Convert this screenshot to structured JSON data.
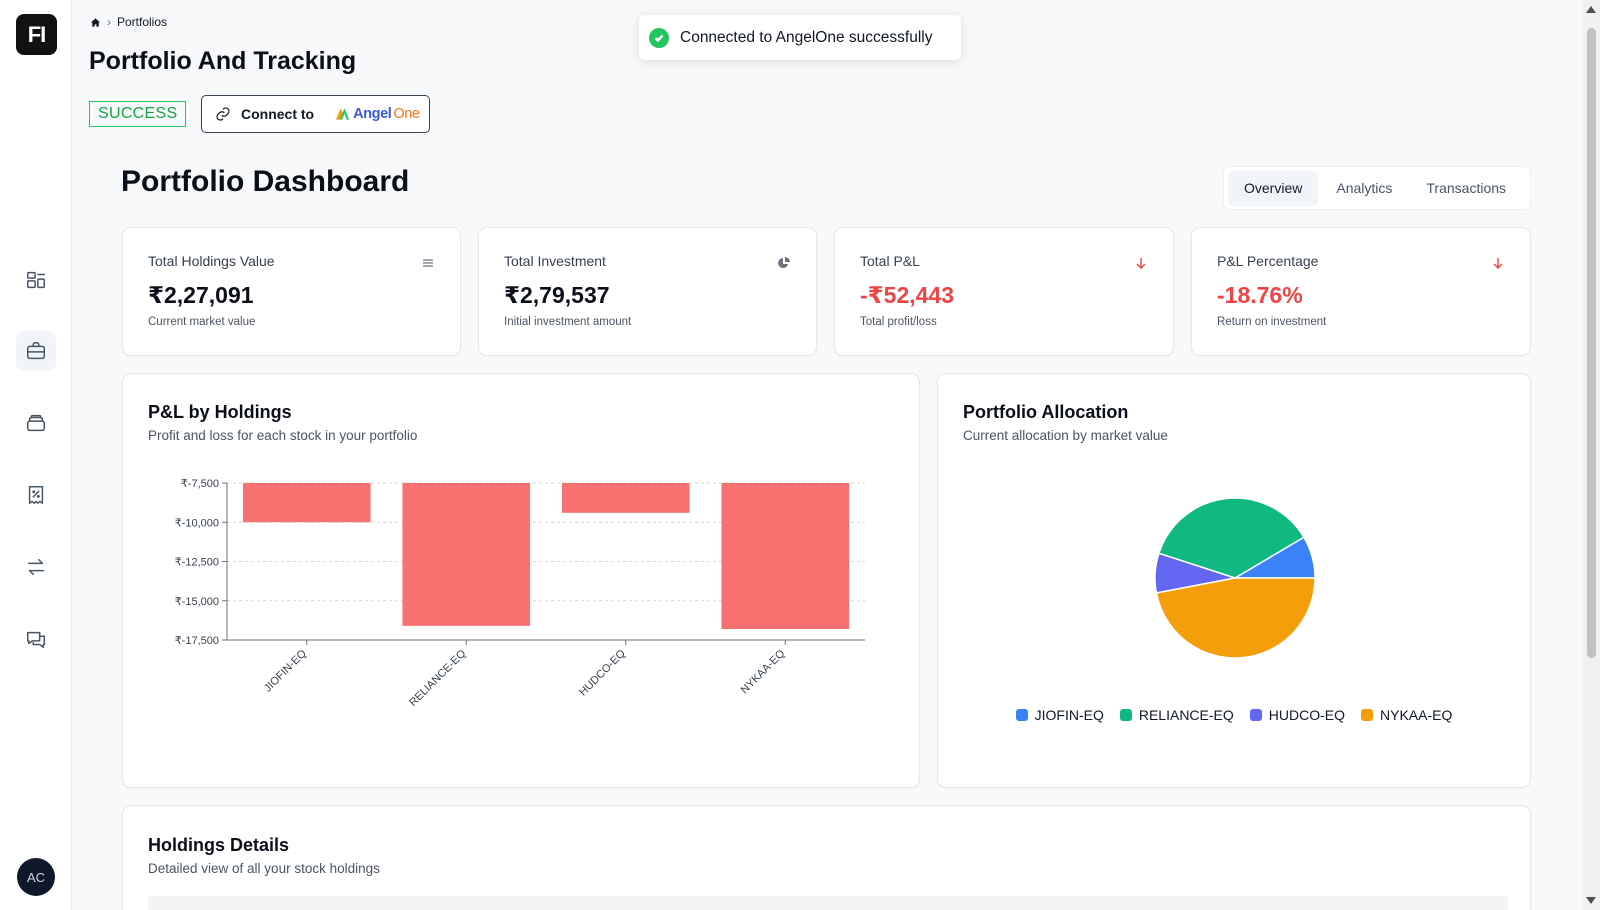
{
  "sidebar": {
    "logo": "FI",
    "items": [
      {
        "name": "dashboard",
        "icon": "dashboard-icon"
      },
      {
        "name": "portfolio",
        "icon": "briefcase-icon",
        "active": true
      },
      {
        "name": "accounts",
        "icon": "layers-icon"
      },
      {
        "name": "tax",
        "icon": "receipt-percent-icon"
      },
      {
        "name": "transfers",
        "icon": "arrows-swap-icon"
      },
      {
        "name": "chat",
        "icon": "chat-icon"
      }
    ],
    "avatar": "AC"
  },
  "breadcrumb": {
    "home_icon": "home-icon",
    "current": "Portfolios"
  },
  "header": {
    "title": "Portfolio And Tracking",
    "status": "SUCCESS",
    "connect_label": "Connect to",
    "brand_angel": "Angel",
    "brand_one": "One"
  },
  "toast": {
    "message": "Connected to AngelOne successfully"
  },
  "dashboard": {
    "title": "Portfolio Dashboard",
    "tabs": [
      "Overview",
      "Analytics",
      "Transactions"
    ],
    "active_tab": "Overview"
  },
  "stats": [
    {
      "label": "Total Holdings Value",
      "value": "₹2,27,091",
      "sub": "Current market value",
      "icon": "list-icon"
    },
    {
      "label": "Total Investment",
      "value": "₹2,79,537",
      "sub": "Initial investment amount",
      "icon": "pie-icon"
    },
    {
      "label": "Total P&L",
      "value": "-₹52,443",
      "sub": "Total profit/loss",
      "icon": "arrow-down-icon"
    },
    {
      "label": "P&L Percentage",
      "value": "-18.76%",
      "sub": "Return on investment",
      "icon": "arrow-down-icon"
    }
  ],
  "pl_card": {
    "title": "P&L by Holdings",
    "subtitle": "Profit and loss for each stock in your portfolio"
  },
  "alloc_card": {
    "title": "Portfolio Allocation",
    "subtitle": "Current allocation by market value"
  },
  "holdings_card": {
    "title": "Holdings Details",
    "subtitle": "Detailed view of all your stock holdings"
  },
  "colors": {
    "negative": "#ef4444",
    "bar": "#f87171",
    "success": "#22c55e"
  },
  "chart_data": [
    {
      "type": "bar",
      "categories": [
        "JIOFIN-EQ",
        "RELIANCE-EQ",
        "HUDCO-EQ",
        "NYKAA-EQ"
      ],
      "values": [
        -10000,
        -16600,
        -9400,
        -16800
      ],
      "yticks": [
        "₹-7,500",
        "₹-10,000",
        "₹-12,500",
        "₹-15,000",
        "₹-17,500"
      ],
      "ylim": [
        -17500,
        -7500
      ],
      "grid": true
    },
    {
      "type": "pie",
      "labels": [
        "JIOFIN-EQ",
        "RELIANCE-EQ",
        "HUDCO-EQ",
        "NYKAA-EQ"
      ],
      "values": [
        8.5,
        36.5,
        8.0,
        47.0
      ],
      "colors": [
        "#3b82f6",
        "#10b981",
        "#6366f1",
        "#f59e0b"
      ],
      "legend": "bottom"
    }
  ]
}
